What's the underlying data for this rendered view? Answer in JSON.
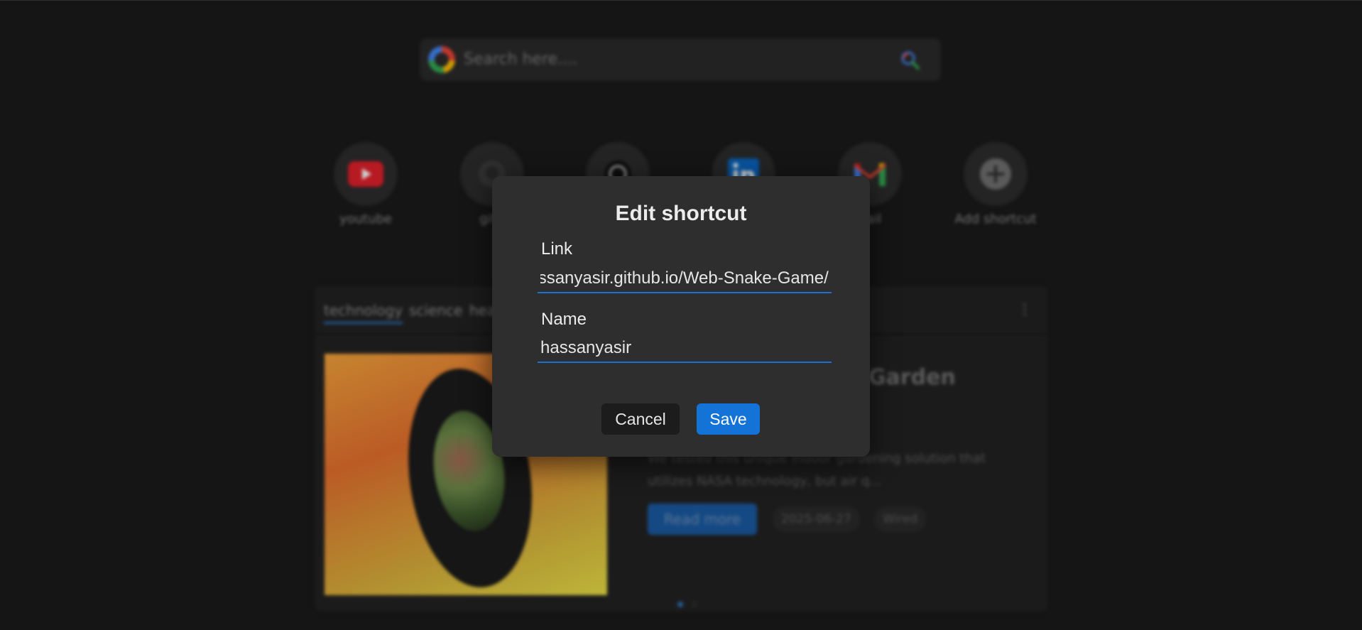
{
  "search": {
    "placeholder": "Search here....",
    "icon": "search-icon"
  },
  "shortcuts": [
    {
      "label": "youtube",
      "icon": "youtube-icon",
      "color": "#e0202b"
    },
    {
      "label": "gith",
      "icon": "github-icon",
      "color": "#555555"
    },
    {
      "label": "",
      "icon": "chatgpt-icon",
      "color": "#bdbdbd"
    },
    {
      "label": "",
      "icon": "linkedin-icon",
      "color": "#0a66c2"
    },
    {
      "label": "nail",
      "icon": "gmail-icon",
      "color": "#ea4335"
    },
    {
      "label": "Add shortcut",
      "icon": "add-icon",
      "color": "#6e6e6e"
    }
  ],
  "news": {
    "tabs": [
      "technology",
      "science",
      "hea"
    ],
    "active_tab": "technology",
    "title": "door Garden",
    "description": "We tested this unique indoor gardening solution that utilizes NASA technology, but air q...",
    "read_more": "Read more",
    "date": "2025-06-27",
    "source": "Wired"
  },
  "modal": {
    "title": "Edit shortcut",
    "link_label": "Link",
    "link_value": "hassanyasir.github.io/Web-Snake-Game/",
    "name_label": "Name",
    "name_value": "hassanyasir",
    "cancel_label": "Cancel",
    "save_label": "Save"
  },
  "colors": {
    "accent": "#1473d6",
    "background": "#1a1a1a",
    "modal_background": "#2e2e2e"
  }
}
